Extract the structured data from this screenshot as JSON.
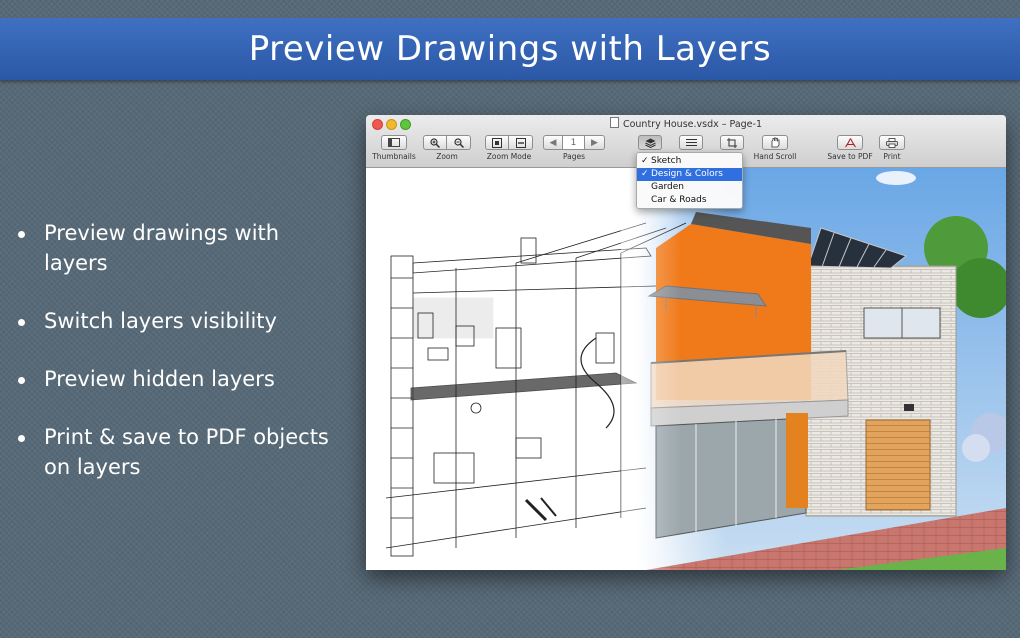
{
  "banner": {
    "title": "Preview Drawings with Layers"
  },
  "bullets": [
    "Preview drawings with layers",
    "Switch layers visibility",
    "Preview hidden layers",
    "Print & save to PDF objects on layers"
  ],
  "window": {
    "title": "Country House.vsdx – Page-1",
    "toolbar": {
      "thumbnails": "Thumbnails",
      "zoom": "Zoom",
      "zoom_mode": "Zoom Mode",
      "pages": "Pages",
      "page_number": "1",
      "hand_scroll": "Hand Scroll",
      "save_pdf": "Save to PDF",
      "print": "Print"
    },
    "layers_menu": {
      "items": [
        {
          "label": "Sketch",
          "checked": true,
          "selected": false
        },
        {
          "label": "Design & Colors",
          "checked": true,
          "selected": true
        },
        {
          "label": "Garden",
          "checked": false,
          "selected": false
        },
        {
          "label": "Car & Roads",
          "checked": false,
          "selected": false
        }
      ]
    }
  },
  "colors": {
    "banner": "#3465b8",
    "background": "#566876",
    "menu_selection": "#2f6fe0",
    "orange_wall": "#f07a1a"
  }
}
